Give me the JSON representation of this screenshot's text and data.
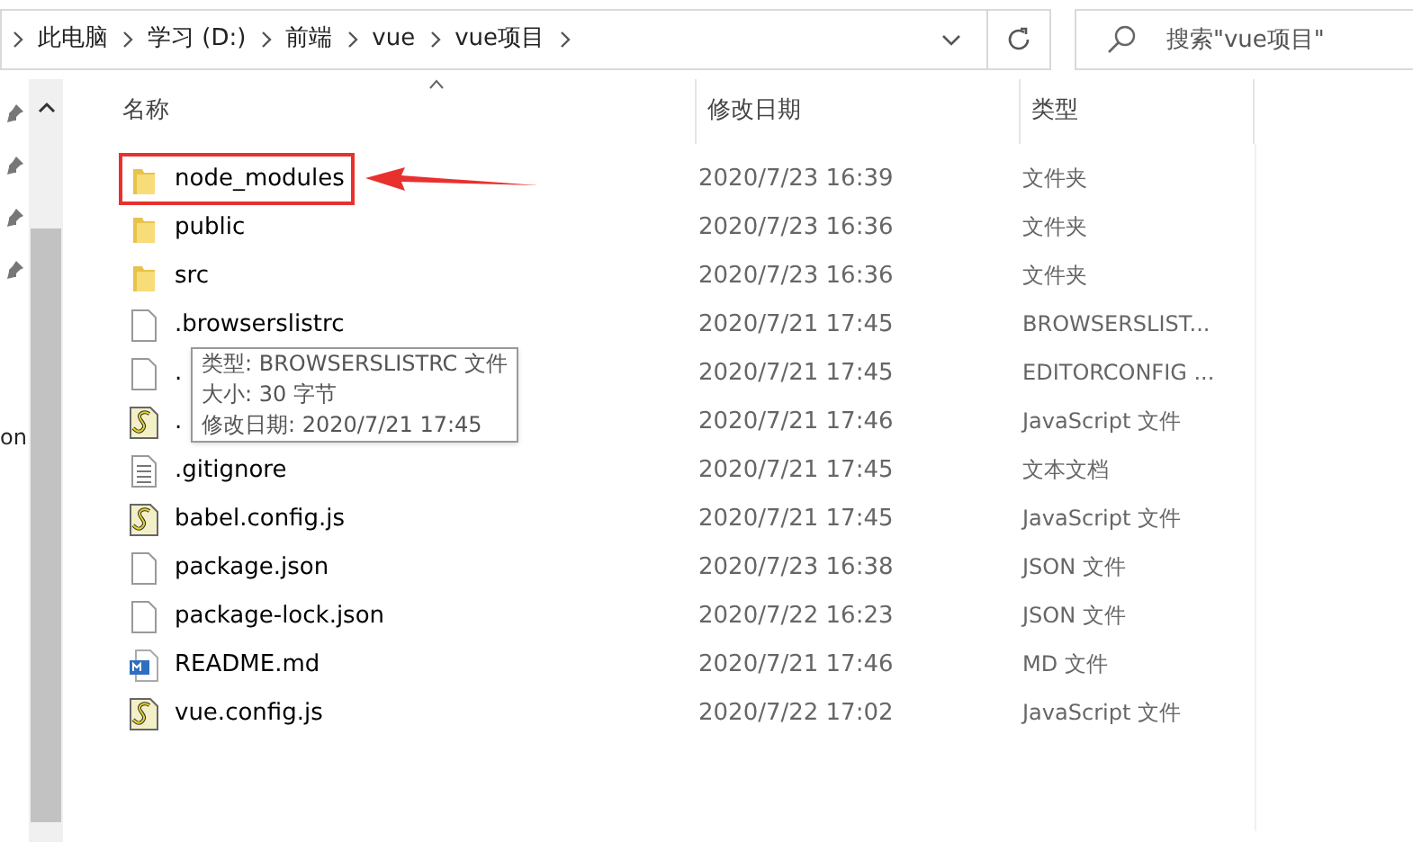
{
  "address_bar": {
    "crumbs": [
      "此电脑",
      "学习 (D:)",
      "前端",
      "vue",
      "vue项目"
    ]
  },
  "search": {
    "placeholder": "搜索\"vue项目\""
  },
  "nav_pane": {
    "cut_text": "on"
  },
  "table": {
    "columns": [
      "名称",
      "修改日期",
      "类型"
    ],
    "rows": [
      {
        "kind": "folder",
        "name": "node_modules",
        "date": "2020/7/23 16:39",
        "type": "文件夹",
        "highlighted": true
      },
      {
        "kind": "folder",
        "name": "public",
        "date": "2020/7/23 16:36",
        "type": "文件夹",
        "highlighted": false
      },
      {
        "kind": "folder",
        "name": "src",
        "date": "2020/7/23 16:36",
        "type": "文件夹",
        "highlighted": false
      },
      {
        "kind": "file",
        "name": ".browserslistrc",
        "date": "2020/7/21 17:45",
        "type": "BROWSERSLIST...",
        "highlighted": false
      },
      {
        "kind": "file",
        "name": ".",
        "date": "2020/7/21 17:45",
        "type": "EDITORCONFIG ...",
        "highlighted": false
      },
      {
        "kind": "script",
        "name": ".",
        "date": "2020/7/21 17:46",
        "type": "JavaScript 文件",
        "highlighted": false
      },
      {
        "kind": "text",
        "name": ".gitignore",
        "date": "2020/7/21 17:45",
        "type": "文本文档",
        "highlighted": false
      },
      {
        "kind": "script",
        "name": "babel.config.js",
        "date": "2020/7/21 17:45",
        "type": "JavaScript 文件",
        "highlighted": false
      },
      {
        "kind": "file",
        "name": "package.json",
        "date": "2020/7/23 16:38",
        "type": "JSON 文件",
        "highlighted": false
      },
      {
        "kind": "file",
        "name": "package-lock.json",
        "date": "2020/7/22 16:23",
        "type": "JSON 文件",
        "highlighted": false
      },
      {
        "kind": "markdown",
        "name": "README.md",
        "date": "2020/7/21 17:46",
        "type": "MD 文件",
        "highlighted": false
      },
      {
        "kind": "script",
        "name": "vue.config.js",
        "date": "2020/7/22 17:02",
        "type": "JavaScript 文件",
        "highlighted": false
      }
    ]
  },
  "tooltip": {
    "lines": [
      "类型: BROWSERSLISTRC 文件",
      "大小: 30 字节",
      "修改日期: 2020/7/21 17:45"
    ]
  }
}
